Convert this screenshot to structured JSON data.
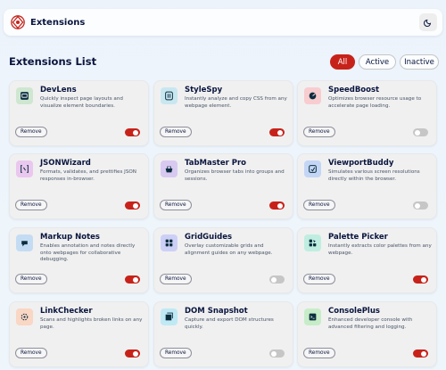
{
  "header": {
    "app_name": "Extensions",
    "theme_toggle_icon": "moon-icon"
  },
  "main": {
    "title": "Extensions List",
    "filters": [
      {
        "label": "All",
        "selected": true
      },
      {
        "label": "Active",
        "selected": false
      },
      {
        "label": "Inactive",
        "selected": false
      }
    ]
  },
  "colors": {
    "accent": "#c7221a",
    "text": "#09153e",
    "card_bg": "#f0f0f0",
    "toggle_off": "#c6c6c6"
  },
  "extensions": [
    {
      "name": "DevLens",
      "description": "Quickly inspect page layouts and visualize element boundaries.",
      "remove_label": "Remove",
      "active": true,
      "icon": "devlens-icon",
      "icon_bg": "#cfe6d0"
    },
    {
      "name": "StyleSpy",
      "description": "Instantly analyze and copy CSS from any webpage element.",
      "remove_label": "Remove",
      "active": true,
      "icon": "stylespy-icon",
      "icon_bg": "#c9e7f0"
    },
    {
      "name": "SpeedBoost",
      "description": "Optimizes browser resource usage to accelerate page loading.",
      "remove_label": "Remove",
      "active": false,
      "icon": "speedboost-icon",
      "icon_bg": "#f8cdd0"
    },
    {
      "name": "JSONWizard",
      "description": "Formats, validates, and prettifies JSON responses in-browser.",
      "remove_label": "Remove",
      "active": true,
      "icon": "jsonwizard-icon",
      "icon_bg": "#eac7ef"
    },
    {
      "name": "TabMaster Pro",
      "description": "Organizes browser tabs into groups and sessions.",
      "remove_label": "Remove",
      "active": true,
      "icon": "tabmaster-icon",
      "icon_bg": "#d8c9f1"
    },
    {
      "name": "ViewportBuddy",
      "description": "Simulates various screen resolutions directly within the browser.",
      "remove_label": "Remove",
      "active": false,
      "icon": "viewportbuddy-icon",
      "icon_bg": "#c4d6f5"
    },
    {
      "name": "Markup Notes",
      "description": "Enables annotation and notes directly onto webpages for collaborative debugging.",
      "remove_label": "Remove",
      "active": true,
      "icon": "markupnotes-icon",
      "icon_bg": "#c4dcf3"
    },
    {
      "name": "GridGuides",
      "description": "Overlay customizable grids and alignment guides on any webpage.",
      "remove_label": "Remove",
      "active": false,
      "icon": "gridguides-icon",
      "icon_bg": "#cdd0f6"
    },
    {
      "name": "Palette Picker",
      "description": "Instantly extracts color palettes from any webpage.",
      "remove_label": "Remove",
      "active": true,
      "icon": "palettepicker-icon",
      "icon_bg": "#bfeee0"
    },
    {
      "name": "LinkChecker",
      "description": "Scans and highlights broken links on any page.",
      "remove_label": "Remove",
      "active": true,
      "icon": "linkchecker-icon",
      "icon_bg": "#fad6c4"
    },
    {
      "name": "DOM Snapshot",
      "description": "Capture and export DOM structures quickly.",
      "remove_label": "Remove",
      "active": false,
      "icon": "domsnapshot-icon",
      "icon_bg": "#bfe9f4"
    },
    {
      "name": "ConsolePlus",
      "description": "Enhanced developer console with advanced filtering and logging.",
      "remove_label": "Remove",
      "active": true,
      "icon": "consoleplus-icon",
      "icon_bg": "#c7edc8"
    }
  ]
}
